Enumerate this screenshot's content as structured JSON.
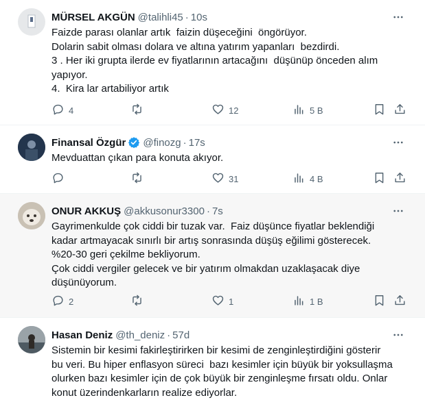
{
  "tweets": [
    {
      "name": "MÜRSEL AKGÜN",
      "handle": "@talihli45",
      "time": "10s",
      "verified": false,
      "lines": [
        "Faizde parası olanlar artık  faizin düşeceğini  öngörüyor.",
        "Dolarin sabit olması dolara ve altına yatırım yapanları  bezdirdi.",
        "3 . Her iki grupta ilerde ev fiyatlarının artacağını  düşünüp önceden alım",
        "yapıyor.",
        "4.  Kira lar artabiliyor artık"
      ],
      "stats": {
        "reply": "4",
        "retweet": "",
        "like": "12",
        "views": "5 B"
      }
    },
    {
      "name": "Finansal Özgür",
      "handle": "@finozg",
      "time": "17s",
      "verified": true,
      "lines": [
        "Mevduattan çıkan para konuta akıyor."
      ],
      "stats": {
        "reply": "",
        "retweet": "",
        "like": "31",
        "views": "4 B"
      }
    },
    {
      "name": "ONUR AKKUŞ",
      "handle": "@akkusonur3300",
      "time": "7s",
      "verified": false,
      "lines": [
        "Gayrimenkulde çok ciddi bir tuzak var.  Faiz düşünce fiyatlar beklendiği",
        "kadar artmayacak sınırlı bir artış sonrasında düşüş eğilimi gösterecek.",
        "%20-30 geri çekilme bekliyorum.",
        "Çok ciddi vergiler gelecek ve bir yatırım olmakdan uzaklaşacak diye",
        "düşünüyorum."
      ],
      "stats": {
        "reply": "2",
        "retweet": "",
        "like": "1",
        "views": "1 B"
      }
    },
    {
      "name": "Hasan Deniz",
      "handle": "@th_deniz",
      "time": "57d",
      "verified": false,
      "lines": [
        "Sistemin bir kesimi fakirleştirirken bir kesimi de zenginleştirdiğini gösterir",
        "bu veri. Bu hiper enflasyon süreci  bazı kesimler için büyük bir yoksullaşma",
        "olurken bazı kesimler için de çok büyük bir zenginleşme fırsatı oldu. Onlar",
        "konut üzerindenkarların realize ediyorlar."
      ],
      "stats": {
        "reply": "",
        "retweet": "",
        "like": "",
        "views": ""
      }
    }
  ],
  "colors": {
    "verified": "#1d9bf0",
    "muted": "#536471",
    "text": "#0f1419",
    "highlight_bg": "#f7f7f7"
  }
}
